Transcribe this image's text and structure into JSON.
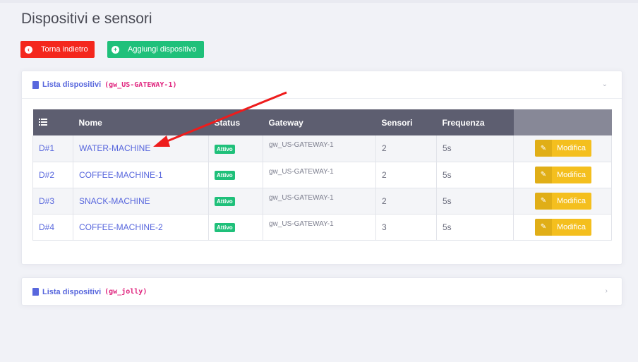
{
  "page": {
    "title": "Dispositivi e sensori"
  },
  "buttons": {
    "back_label": "Torna indietro",
    "add_label": "Aggiungi dispositivo"
  },
  "cards": [
    {
      "title": "Lista dispositivi",
      "gateway_code": "(gw_US-GATEWAY-1)",
      "expanded": true
    },
    {
      "title": "Lista dispositivi",
      "gateway_code": "(gw_jolly)",
      "expanded": false
    }
  ],
  "table": {
    "headers": {
      "icon": "list-icon",
      "name": "Nome",
      "status": "Status",
      "gateway": "Gateway",
      "sensors": "Sensori",
      "frequency": "Frequenza",
      "actions": ""
    },
    "rows": [
      {
        "id": "D#1",
        "name": "WATER-MACHINE",
        "status": "Attivo",
        "gateway": "gw_US-GATEWAY-1",
        "sensors": "2",
        "frequency": "5s",
        "action": "Modifica"
      },
      {
        "id": "D#2",
        "name": "COFFEE-MACHINE-1",
        "status": "Attivo",
        "gateway": "gw_US-GATEWAY-1",
        "sensors": "2",
        "frequency": "5s",
        "action": "Modifica"
      },
      {
        "id": "D#3",
        "name": "SNACK-MACHINE",
        "status": "Attivo",
        "gateway": "gw_US-GATEWAY-1",
        "sensors": "2",
        "frequency": "5s",
        "action": "Modifica"
      },
      {
        "id": "D#4",
        "name": "COFFEE-MACHINE-2",
        "status": "Attivo",
        "gateway": "gw_US-GATEWAY-1",
        "sensors": "3",
        "frequency": "5s",
        "action": "Modifica"
      }
    ]
  },
  "colors": {
    "back_button": "#f4271d",
    "add_button": "#1fc07a",
    "accent": "#5867dd",
    "code": "#e0267f",
    "edit_button": "#f4bf1e",
    "annotation_arrow": "#ee1c1c"
  }
}
